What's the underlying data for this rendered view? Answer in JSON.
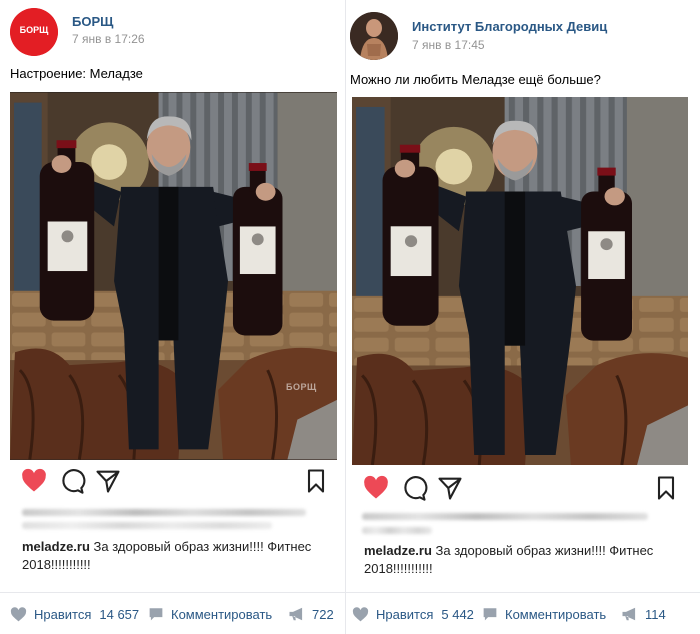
{
  "posts": [
    {
      "author": "БОРЩ",
      "avatar_text": "БОРЩ",
      "time": "7 янв в 17:26",
      "text": "Настроение: Меладзе",
      "watermark": "БОРЩ",
      "caption_user": "meladze.ru",
      "caption_line1": "За здоровый образ жизни!!!! Фитнес",
      "caption_line2": "2018!!!!!!!!!!!",
      "likes_label": "Нравится",
      "likes_count": "14 657",
      "comment_label": "Комментировать",
      "shares_count": "722"
    },
    {
      "author": "Институт Благородных Девиц",
      "time": "7 янв в 17:45",
      "text": "Можно ли любить Меладзе ещё больше?",
      "caption_user": "meladze.ru",
      "caption_line1": "За здоровый образ жизни!!!! Фитнес",
      "caption_line2": "2018!!!!!!!!!!!",
      "likes_label": "Нравится",
      "likes_count": "5 442",
      "comment_label": "Комментировать",
      "shares_count": "114"
    }
  ],
  "colors": {
    "link": "#2a5885",
    "meta": "#939393",
    "heart": "#ed4956",
    "footer_icon": "#99a2ad",
    "avatar_red": "#e31e24"
  },
  "icons": [
    "heart-icon",
    "comment-icon",
    "share-icon",
    "bookmark-icon",
    "like-icon",
    "comment-bubble-icon",
    "megaphone-icon"
  ]
}
